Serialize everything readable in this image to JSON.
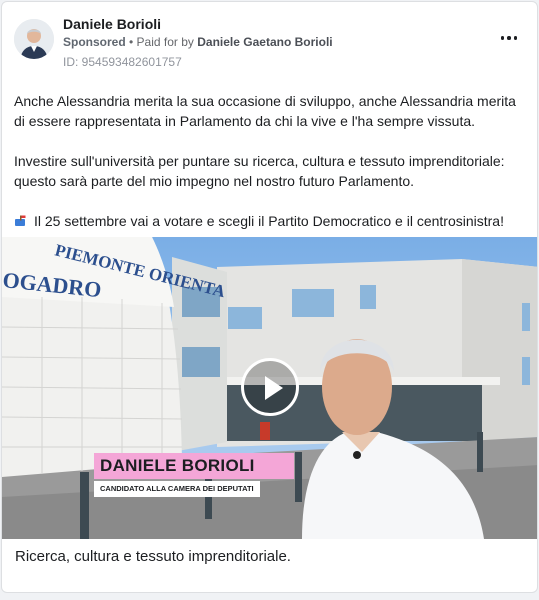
{
  "post": {
    "advertiser_name": "Daniele Borioli",
    "sponsored_label": "Sponsored",
    "separator": " • ",
    "paid_for_prefix": "Paid for by ",
    "paid_for_name": "Daniele Gaetano Borioli",
    "ad_id": "ID: 954593482601757",
    "paragraphs": [
      "Anche Alessandria merita la sua occasione di sviluppo, anche Alessandria merita di essere rappresentata in Parlamento da chi la vive e l'ha sempre vissuta.",
      "Investire sull'università per puntare su ricerca, cultura e tessuto imprenditoriale: questo sarà parte del mio impegno nel nostro futuro Parlamento.",
      "Il 25 settembre vai a votare e scegli il Partito Democratico e il centrosinistra!"
    ],
    "caption": "Ricerca, cultura e tessuto imprenditoriale."
  },
  "video": {
    "sign_line1": "PIEMONTE ORIENTA",
    "sign_line2": "OGADRO",
    "nameplate": "DANIELE BORIOLI",
    "subplate": "CANDIDATO ALLA CAMERA DEI DEPUTATI",
    "nameplate_color": "#f4a6d7"
  },
  "icons": [
    "avatar",
    "more-options-icon",
    "mailbox-icon",
    "play-icon"
  ]
}
